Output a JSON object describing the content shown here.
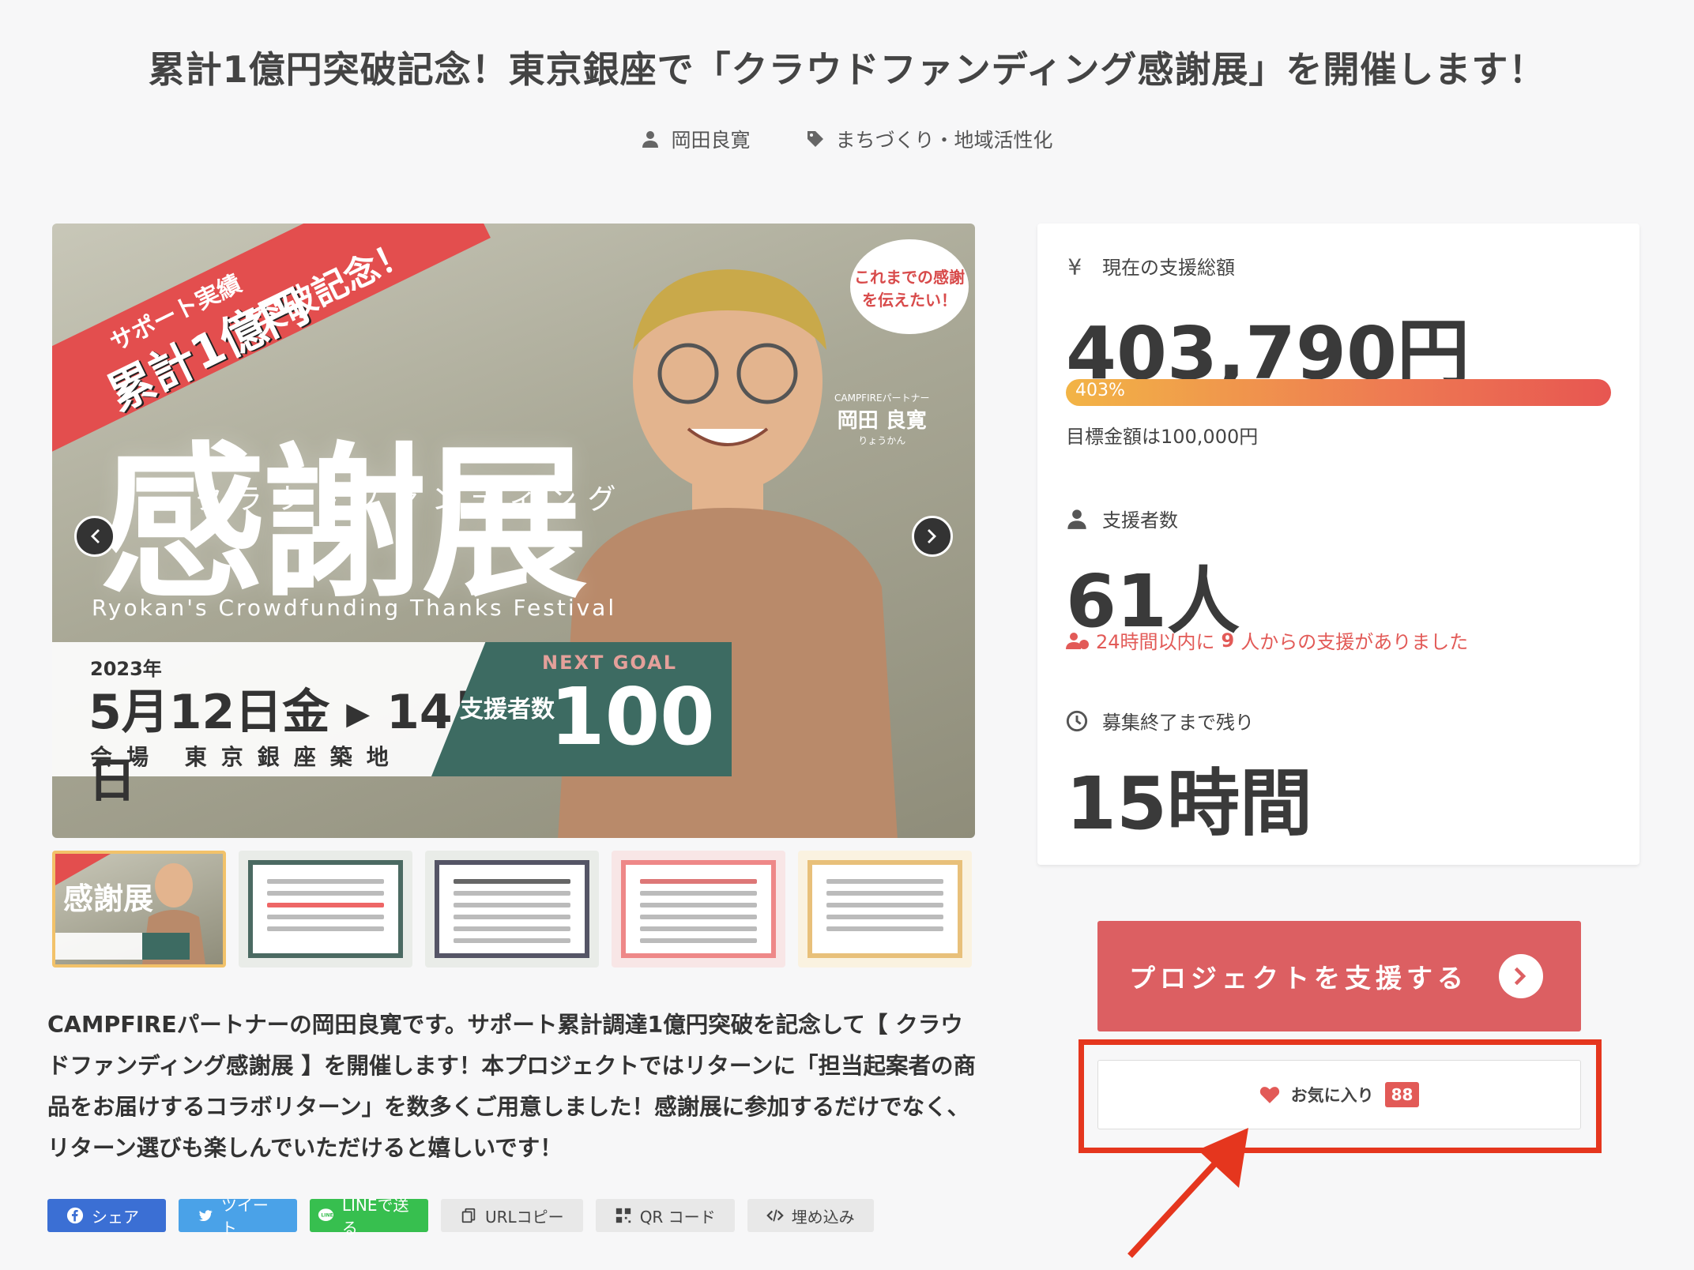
{
  "title": "累計1億円突破記念！東京銀座で「クラウドファンディング感謝展」を開催します！",
  "meta": {
    "author": "岡田良寛",
    "category": "まちづくり・地域活性化"
  },
  "hero": {
    "banner_l1": "サポート実績",
    "banner_l2": "累計1億円",
    "banner_l3": "突破記念！",
    "subtitle": "クラウドファンディング",
    "big_title": "感謝展",
    "english": "Ryokan's Crowdfunding Thanks Festival",
    "year": "2023年",
    "dates": "5月12日金 ▸ 14日日",
    "venue": "会場 東京銀座築地",
    "next_goal": "NEXT GOAL",
    "goal_text": "支援者数",
    "goal_num": "100人",
    "bubble": "これまでの感謝を伝えたい！",
    "partner_small": "CAMPFIREパートナー",
    "partner_name": "岡田 良寛",
    "partner_kana": "りょうかん"
  },
  "description": "CAMPFIREパートナーの岡田良寛です。サポート累計調達1億円突破を記念して【 クラウドファンディング感謝展 】を開催します！本プロジェクトではリターンに「担当起案者の商品をお届けするコラボリターン」を数多くご用意しました！感謝展に参加するだけでなく、リターン選びも楽しんでいただけると嬉しいです！",
  "shares": {
    "facebook": "シェア",
    "twitter": "ツイート",
    "line": "LINEで送る",
    "url": "URLコピー",
    "qr": "QR コード",
    "embed": "埋め込み"
  },
  "panel": {
    "amount_label": "現在の支援総額",
    "amount": "403,790円",
    "percent": "403%",
    "percent_value": 403,
    "goal": "目標金額は100,000円",
    "backers_label": "支援者数",
    "backers": "61人",
    "recent_pre": "24時間以内に",
    "recent_num": "9",
    "recent_post": "人からの支援がありました",
    "remaining_label": "募集終了まで残り",
    "remaining": "15時間"
  },
  "support_button": "プロジェクトを支援する",
  "favorite": {
    "label": "お気に入り",
    "count": "88"
  },
  "colors": {
    "accent": "#dc5f62",
    "highlight": "#e5361e",
    "bar_start": "#f2b446",
    "bar_end": "#e75651"
  }
}
